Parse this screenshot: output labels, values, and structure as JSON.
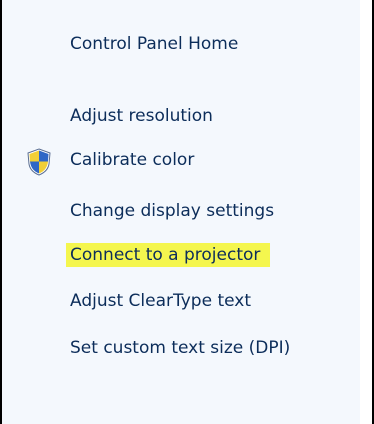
{
  "sidebar": {
    "home_link": "Control Panel Home",
    "links": [
      "Adjust resolution",
      "Calibrate color",
      "Change display settings",
      "Connect to a projector",
      "Adjust ClearType text",
      "Set custom text size (DPI)"
    ]
  },
  "colors": {
    "panel_background": "#f4f8fd",
    "link_text": "#0c2d5a",
    "highlight": "#f4f64e",
    "frame_border": "#000000"
  },
  "icons": {
    "calibrate_color": "uac-shield-icon"
  }
}
